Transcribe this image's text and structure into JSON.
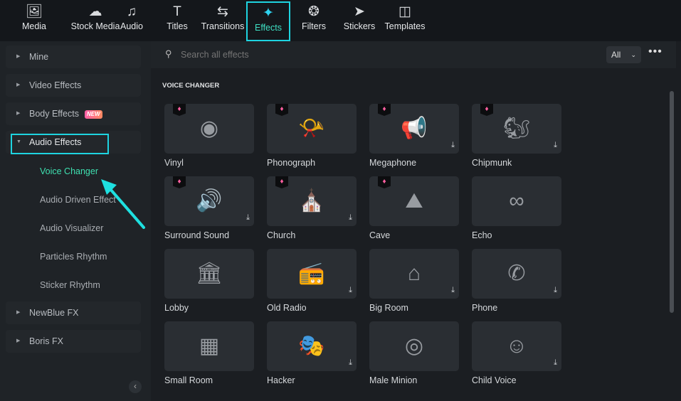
{
  "tabs": [
    {
      "label": "Media",
      "icon": "🖼"
    },
    {
      "label": "Stock Media",
      "icon": "☁"
    },
    {
      "label": "Audio",
      "icon": "♫"
    },
    {
      "label": "Titles",
      "icon": "T"
    },
    {
      "label": "Transitions",
      "icon": "⇆"
    },
    {
      "label": "Effects",
      "icon": "✦"
    },
    {
      "label": "Filters",
      "icon": "❂"
    },
    {
      "label": "Stickers",
      "icon": "➤"
    },
    {
      "label": "Templates",
      "icon": "◫"
    }
  ],
  "sidebar": {
    "items": [
      {
        "label": "Mine"
      },
      {
        "label": "Video Effects"
      },
      {
        "label": "Body Effects",
        "badge": "NEW"
      },
      {
        "label": "Audio Effects"
      },
      {
        "label": "NewBlue FX"
      },
      {
        "label": "Boris FX"
      }
    ],
    "sub_items": [
      "Voice Changer",
      "Audio Driven Effect",
      "Audio Visualizer",
      "Particles Rhythm",
      "Sticker Rhythm"
    ]
  },
  "search": {
    "placeholder": "Search all effects",
    "filter": "All"
  },
  "section_title": "VOICE CHANGER",
  "cards": [
    {
      "label": "Vinyl",
      "icon": "◉",
      "premium": true,
      "download": false
    },
    {
      "label": "Phonograph",
      "icon": "📯",
      "premium": true,
      "download": false
    },
    {
      "label": "Megaphone",
      "icon": "📢",
      "premium": true,
      "download": true
    },
    {
      "label": "Chipmunk",
      "icon": "🐿",
      "premium": true,
      "download": true
    },
    {
      "label": "Surround Sound",
      "icon": "🔊",
      "premium": true,
      "download": true
    },
    {
      "label": "Church",
      "icon": "⛪",
      "premium": true,
      "download": true
    },
    {
      "label": "Cave",
      "icon": "⛰",
      "premium": true,
      "download": false
    },
    {
      "label": "Echo",
      "icon": "∞",
      "premium": false,
      "download": false
    },
    {
      "label": "Lobby",
      "icon": "🏛",
      "premium": false,
      "download": false
    },
    {
      "label": "Old Radio",
      "icon": "📻",
      "premium": false,
      "download": true
    },
    {
      "label": "Big Room",
      "icon": "⌂",
      "premium": false,
      "download": true
    },
    {
      "label": "Phone",
      "icon": "✆",
      "premium": false,
      "download": true
    },
    {
      "label": "Small Room",
      "icon": "▦",
      "premium": false,
      "download": false
    },
    {
      "label": "Hacker",
      "icon": "🎭",
      "premium": false,
      "download": true
    },
    {
      "label": "Male Minion",
      "icon": "◎",
      "premium": false,
      "download": false
    },
    {
      "label": "Child Voice",
      "icon": "☺",
      "premium": false,
      "download": true
    }
  ]
}
